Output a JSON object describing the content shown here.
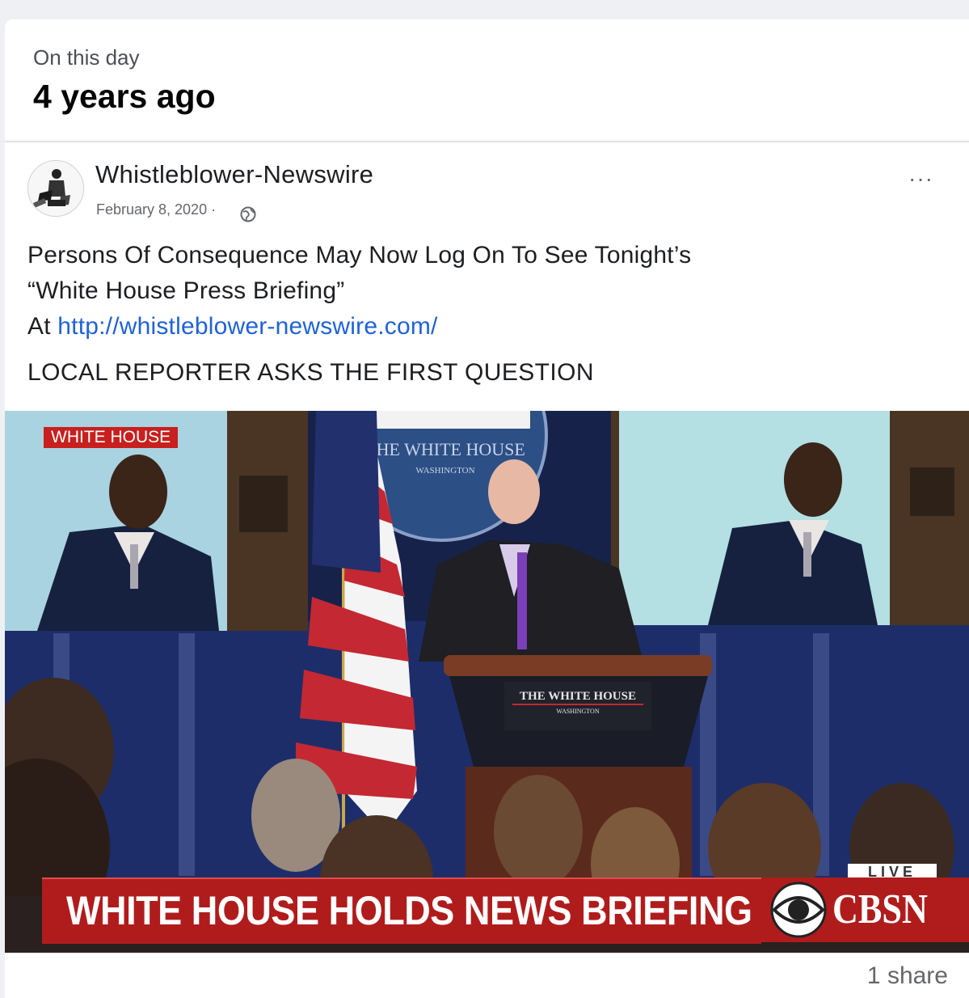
{
  "memory": {
    "kicker": "On this day",
    "title": "4 years ago"
  },
  "post": {
    "author": "Whistleblower-Newswire",
    "date": "February 8, 2020 ·",
    "text_line1": "Persons Of Consequence May Now Log On To See Tonight’s",
    "text_line2": "“White House Press Briefing”",
    "text_line3_prefix": "At ",
    "link": "http://whistleblower-newswire.com/",
    "caption": "LOCAL REPORTER ASKS THE FIRST QUESTION",
    "more_label": "···"
  },
  "media": {
    "corner_bug": "WHITE HOUSE",
    "seal_text": "THE WHITE HOUSE",
    "seal_subtext": "WASHINGTON",
    "podium_text": "THE WHITE HOUSE",
    "podium_subtext": "WASHINGTON",
    "banner": "WHITE HOUSE HOLDS NEWS BRIEFING",
    "live_tag": "LIVE",
    "network": "CBSN"
  },
  "footer": {
    "shares": "1 share"
  },
  "colors": {
    "link": "#2062d6",
    "banner_red": "#b01c1c",
    "background": "#eef0f3"
  }
}
